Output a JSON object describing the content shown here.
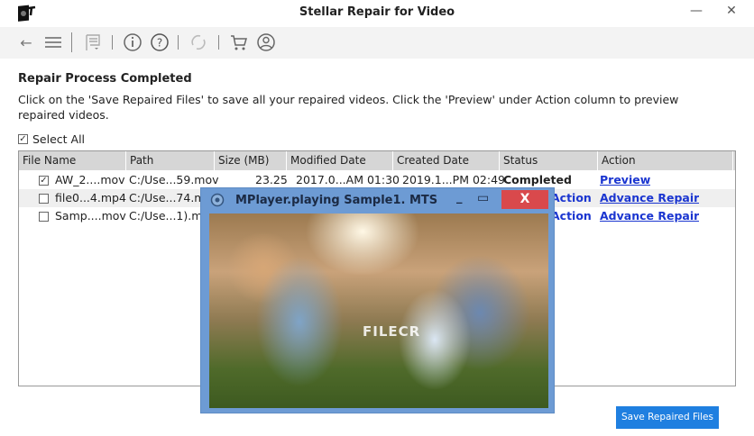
{
  "app": {
    "title": "Stellar Repair for Video",
    "minimize": "—",
    "close": "✕"
  },
  "toolbar": {
    "items": [
      "back-icon",
      "menu-icon",
      "flag-icon",
      "info-icon",
      "help-icon",
      "refresh-icon",
      "cart-icon",
      "account-icon"
    ]
  },
  "main": {
    "heading": "Repair Process Completed",
    "description": "Click on the 'Save Repaired Files' to save all your repaired videos. Click the 'Preview' under Action column to preview repaired videos.",
    "select_all": "Select All"
  },
  "table": {
    "columns": [
      "File Name",
      "Path",
      "Size (MB)",
      "Modified Date",
      "Created Date",
      "Status",
      "Action"
    ],
    "rows": [
      {
        "checked": "✓",
        "name": "AW_2....mov",
        "path": "C:/Use...59.mov",
        "size": "23.25",
        "modified": "2017.0...AM 01:30",
        "created": "2019.1...PM 02:49",
        "status": "Completed",
        "action": "Preview"
      },
      {
        "checked": "",
        "name": "file0...4.mp4",
        "path": "C:/Use...74.m",
        "status": "Action",
        "action": "Advance Repair"
      },
      {
        "checked": "",
        "name": "Samp....mov",
        "path": "C:/Use...1).mo",
        "status": "Action",
        "action": "Advance Repair"
      }
    ]
  },
  "player": {
    "title": "MPlayer.playing Sample1. MTS",
    "minimize": "_",
    "maximize": "▭",
    "close": "X",
    "watermark": "FILECR"
  },
  "footer": {
    "save_button": "Save Repaired Files"
  },
  "colors": {
    "accent": "#1f7fe0",
    "player_frame": "#6d9bd4",
    "close": "#d9494c",
    "link": "#1a35d0"
  }
}
